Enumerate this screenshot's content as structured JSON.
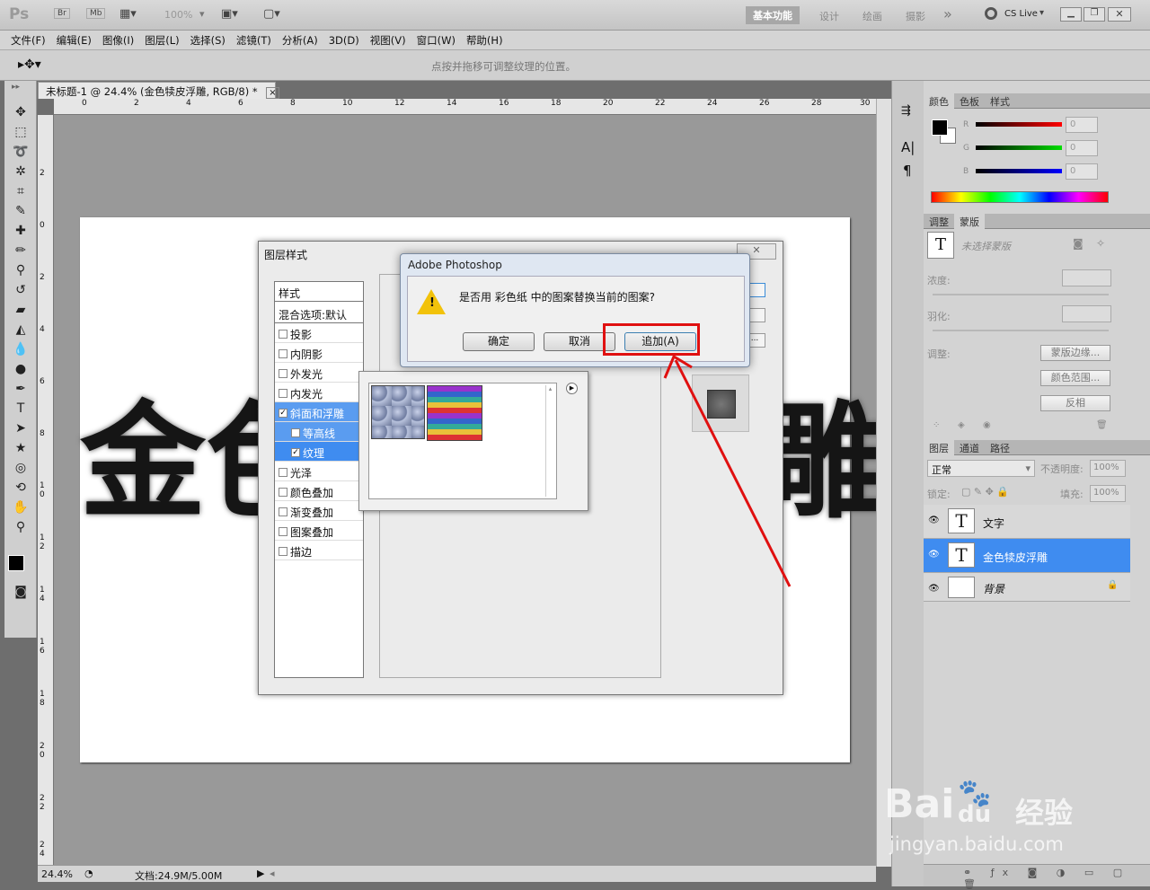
{
  "appbar": {
    "logo": "Ps",
    "br": "Br",
    "mb": "Mb",
    "zoom": "100%",
    "workspaces": [
      "基本功能",
      "设计",
      "绘画",
      "摄影"
    ],
    "more": "»",
    "cslive": "CS Live"
  },
  "menu": [
    "文件(F)",
    "编辑(E)",
    "图像(I)",
    "图层(L)",
    "选择(S)",
    "滤镜(T)",
    "分析(A)",
    "3D(D)",
    "视图(V)",
    "窗口(W)",
    "帮助(H)"
  ],
  "options": {
    "hint": "点按并拖移可调整纹理的位置。"
  },
  "document": {
    "tab_title": "未标题-1 @ 24.4% (金色犊皮浮雕, RGB/8) *",
    "close": "×",
    "ruler_top": [
      "0",
      "2",
      "4",
      "6",
      "8",
      "10",
      "12",
      "14",
      "16",
      "18",
      "20",
      "22",
      "24",
      "26",
      "28",
      "30"
    ],
    "ruler_left": [
      "2",
      "0",
      "2",
      "4",
      "6",
      "8",
      "1 0",
      "1 2",
      "1 4",
      "1 6",
      "1 8",
      "2 0",
      "2 2",
      "2 4"
    ],
    "canvas_chars": [
      "金",
      "色",
      "雕"
    ]
  },
  "status": {
    "zoom": "24.4%",
    "doc": "文档:24.9M/5.00M"
  },
  "color_panel": {
    "tabs": [
      "颜色",
      "色板",
      "样式"
    ],
    "channels": [
      {
        "label": "R",
        "value": "0"
      },
      {
        "label": "G",
        "value": "0"
      },
      {
        "label": "B",
        "value": "0"
      }
    ]
  },
  "masks_panel": {
    "tabs": [
      "调整",
      "蒙版"
    ],
    "none_selected": "未选择蒙版",
    "density": "浓度:",
    "feather": "羽化:",
    "refine": "调整:",
    "buttons": [
      "蒙版边缘...",
      "颜色范围...",
      "反相"
    ]
  },
  "layers_panel": {
    "tabs": [
      "图层",
      "通道",
      "路径"
    ],
    "blend_mode": "正常",
    "opacity_label": "不透明度:",
    "opacity": "100%",
    "lock_label": "锁定:",
    "fill_label": "填充:",
    "fill": "100%",
    "layers": [
      {
        "name": "文字",
        "thumb": "T"
      },
      {
        "name": "金色犊皮浮雕",
        "thumb": "T"
      },
      {
        "name": "背景",
        "thumb": ""
      }
    ]
  },
  "layer_style": {
    "title": "图层样式",
    "styles_header": "样式",
    "blend_default": "混合选项:默认",
    "items": [
      {
        "label": "投影",
        "checked": false
      },
      {
        "label": "内阴影",
        "checked": false
      },
      {
        "label": "外发光",
        "checked": false
      },
      {
        "label": "内发光",
        "checked": false
      },
      {
        "label": "斜面和浮雕",
        "checked": true
      },
      {
        "label": "等高线",
        "checked": false
      },
      {
        "label": "纹理",
        "checked": true
      },
      {
        "label": "光泽",
        "checked": false
      },
      {
        "label": "颜色叠加",
        "checked": false
      },
      {
        "label": "渐变叠加",
        "checked": false
      },
      {
        "label": "图案叠加",
        "checked": false
      },
      {
        "label": "描边",
        "checked": false
      }
    ]
  },
  "alert": {
    "title": "Adobe Photoshop",
    "message": "是否用 彩色纸 中的图案替换当前的图案?",
    "ok": "确定",
    "cancel": "取消",
    "append": "追加(A)"
  },
  "watermark": {
    "brand": "Bai",
    "brand2": "du",
    "cn": "经验",
    "url": "jingyan.baidu.com"
  }
}
